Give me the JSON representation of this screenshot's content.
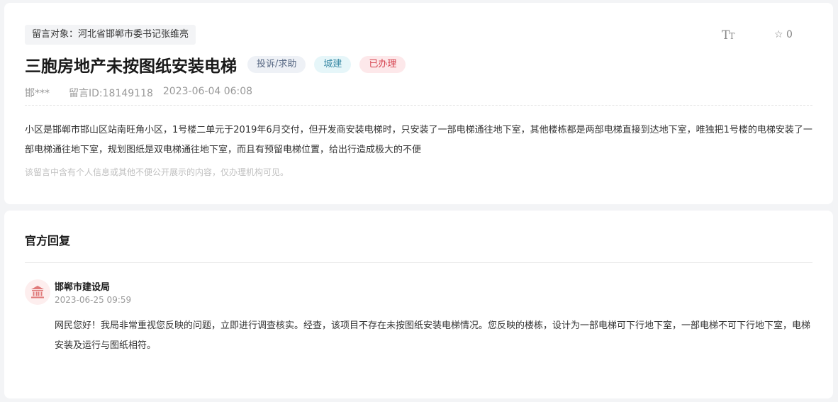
{
  "message": {
    "target": "留言对象：河北省邯郸市委书记张维亮",
    "font_size_glyph_big": "T",
    "font_size_glyph_small": "T",
    "favorite_icon": "star-outline-icon",
    "favorite_count": "0",
    "title": "三胞房地产未按图纸安装电梯",
    "tags": {
      "type": "投诉/求助",
      "category": "城建",
      "status": "已办理"
    },
    "author": "邯***",
    "message_id": "留言ID:18149118",
    "datetime": "2023-06-04 06:08",
    "content": "小区是邯郸市邯山区站南旺角小区，1号楼二单元于2019年6月交付，但开发商安装电梯时，只安装了一部电梯通往地下室，其他楼栋都是两部电梯直接到达地下室，唯独把1号楼的电梯安装了一部电梯通往地下室，规划图纸是双电梯通往地下室，而且有预留电梯位置，给出行造成极大的不便",
    "privacy_note": "该留言中含有个人信息或其他不便公开展示的内容，仅办理机构可见。"
  },
  "reply": {
    "heading": "官方回复",
    "avatar_icon": "government-building-icon",
    "org_name": "邯郸市建设局",
    "datetime": "2023-06-25 09:59",
    "content": "网民您好！我局非常重视您反映的问题，立即进行调查核实。经查，该项目不存在未按图纸安装电梯情况。您反映的楼栋，设计为一部电梯可下行地下室，一部电梯不可下行地下室，电梯安装及运行与图纸相符。"
  },
  "colors": {
    "status_red": "#d5424e",
    "category_teal": "#3a8aa5",
    "type_slate": "#5a6a85",
    "avatar_icon_red": "#e07a7a"
  }
}
